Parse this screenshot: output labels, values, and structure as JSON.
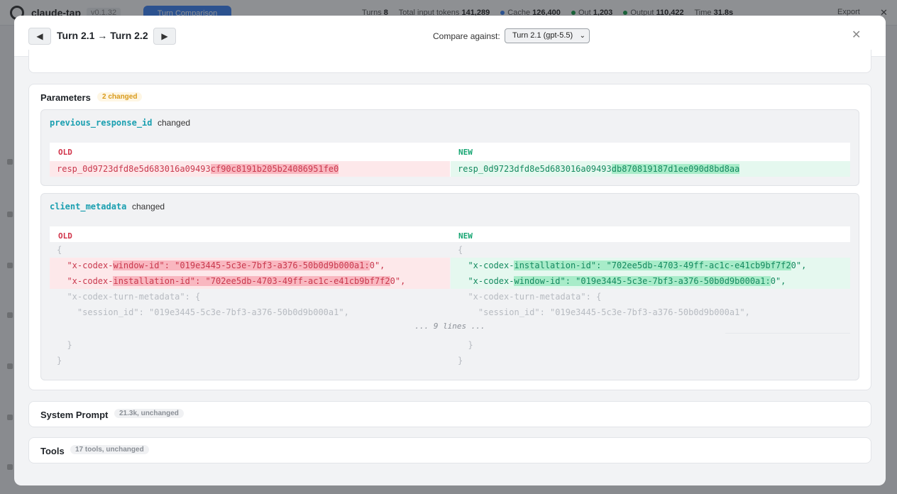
{
  "background": {
    "logo": "claude-tap",
    "version": "v0.1.32",
    "primary_button": "Turn Comparison",
    "stats": [
      {
        "label": "Turns",
        "value": "8"
      },
      {
        "label": "Total input tokens",
        "value": "141,289"
      },
      {
        "label": "Cache",
        "value": "126,400",
        "color": "#3b82f6"
      },
      {
        "label": "Out",
        "value": "1,203",
        "color": "#16a34a"
      },
      {
        "label": "Output",
        "value": "110,422",
        "color": "#16a34a"
      },
      {
        "label": "Time",
        "value": "31.8s"
      }
    ],
    "export_label": "Export"
  },
  "modal": {
    "nav": {
      "prev_icon": "◀",
      "next_icon": "▶",
      "title": "Turn 2.1 → Turn 2.2"
    },
    "compare": {
      "label": "Compare against:",
      "selected": "Turn 2.1 (gpt-5.5)",
      "chevron": "⌄"
    },
    "close_icon": "✕",
    "parameters": {
      "title": "Parameters",
      "badge": "2 changed",
      "items": [
        {
          "name": "previous_response_id",
          "status": "changed",
          "old_header": "OLD",
          "new_header": "NEW",
          "old": {
            "prefix": "resp_0d9723dfd8e5d683016a09493",
            "highlight": "cf90c8191b205b24086951fe0"
          },
          "new": {
            "prefix": "resp_0d9723dfd8e5d683016a09493",
            "highlight": "db870819187d1ee090d8bd8aa"
          }
        },
        {
          "name": "client_metadata",
          "status": "changed",
          "old_header": "OLD",
          "new_header": "NEW",
          "old_lines": [
            {
              "kind": "ctx",
              "text": "{"
            },
            {
              "kind": "del",
              "pre": "  \"x-codex-",
              "hl": "window-id\": \"019e3445-5c3e-7bf3-a376-50b0d9b000a1:",
              "post": "0\","
            },
            {
              "kind": "del",
              "pre": "  \"x-codex-",
              "hl": "installation-id\": \"702ee5db-4703-49ff-ac1c-e41cb9bf7f2",
              "post": "0\","
            },
            {
              "kind": "ctx",
              "text": "  \"x-codex-turn-metadata\": {"
            },
            {
              "kind": "ctx",
              "text": "    \"session_id\": \"019e3445-5c3e-7bf3-a376-50b0d9b000a1\","
            },
            {
              "kind": "ctx",
              "text": "  }"
            },
            {
              "kind": "ctx",
              "text": "}"
            }
          ],
          "new_lines": [
            {
              "kind": "ctx",
              "text": "{"
            },
            {
              "kind": "add",
              "pre": "  \"x-codex-",
              "hl": "installation-id\": \"702ee5db-4703-49ff-ac1c-e41cb9bf7f2",
              "post": "0\","
            },
            {
              "kind": "add",
              "pre": "  \"x-codex-",
              "hl": "window-id\": \"019e3445-5c3e-7bf3-a376-50b0d9b000a1:",
              "post": "0\","
            },
            {
              "kind": "ctx",
              "text": "  \"x-codex-turn-metadata\": {"
            },
            {
              "kind": "ctx",
              "text": "    \"session_id\": \"019e3445-5c3e-7bf3-a376-50b0d9b000a1\","
            },
            {
              "kind": "ctx",
              "text": "  }"
            },
            {
              "kind": "ctx",
              "text": "}"
            }
          ],
          "fold_text": "... 9 lines ..."
        }
      ]
    },
    "system_prompt": {
      "title": "System Prompt",
      "badge": "21.3k, unchanged"
    },
    "tools": {
      "title": "Tools",
      "badge": "17 tools, unchanged"
    }
  }
}
